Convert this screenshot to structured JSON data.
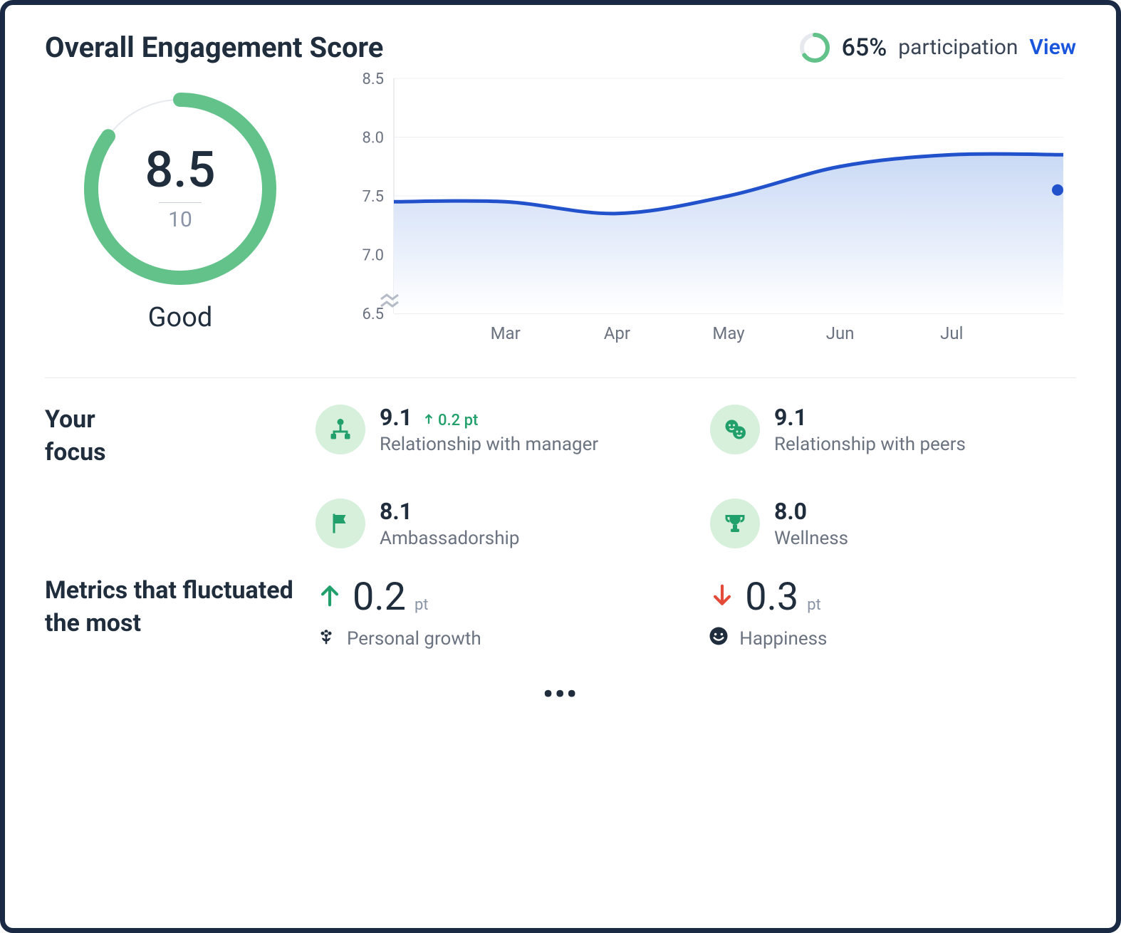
{
  "header": {
    "title": "Overall Engagement Score",
    "participation_pct": "65%",
    "participation_label": "participation",
    "view_label": "View"
  },
  "gauge": {
    "score": "8.5",
    "max": "10",
    "rating": "Good",
    "fill_fraction": 0.85,
    "color": "#62c28a"
  },
  "participation_ring": {
    "fraction": 0.65,
    "color": "#62c28a"
  },
  "chart_data": {
    "type": "line",
    "title": "",
    "xlabel": "",
    "ylabel": "",
    "ylim": [
      6.5,
      8.5
    ],
    "y_ticks": [
      "8.5",
      "8.0",
      "7.5",
      "7.0",
      "6.5"
    ],
    "categories": [
      "Mar",
      "Apr",
      "May",
      "Jun",
      "Jul"
    ],
    "values": [
      7.45,
      7.35,
      7.5,
      7.75,
      7.85
    ],
    "current_point": 7.55,
    "axis_break": true
  },
  "focus": {
    "heading_line1": "Your",
    "heading_line2": "focus",
    "items": [
      {
        "icon": "hierarchy-icon",
        "value": "9.1",
        "delta": "0.2 pt",
        "delta_dir": "up",
        "name": "Relationship with manager"
      },
      {
        "icon": "peers-icon",
        "value": "9.1",
        "delta": "",
        "delta_dir": "",
        "name": "Relationship with peers"
      },
      {
        "icon": "flag-icon",
        "value": "8.1",
        "delta": "",
        "delta_dir": "",
        "name": "Ambassadorship"
      },
      {
        "icon": "trophy-icon",
        "value": "8.0",
        "delta": "",
        "delta_dir": "",
        "name": "Wellness"
      }
    ]
  },
  "fluctuation": {
    "heading_line1": "Metrics that fluctuated",
    "heading_line2": "the most",
    "unit": "pt",
    "items": [
      {
        "dir": "up",
        "value": "0.2",
        "icon": "flower-icon",
        "name": "Personal growth"
      },
      {
        "dir": "down",
        "value": "0.3",
        "icon": "smile-icon",
        "name": "Happiness"
      }
    ]
  },
  "more_indicator": "•••"
}
